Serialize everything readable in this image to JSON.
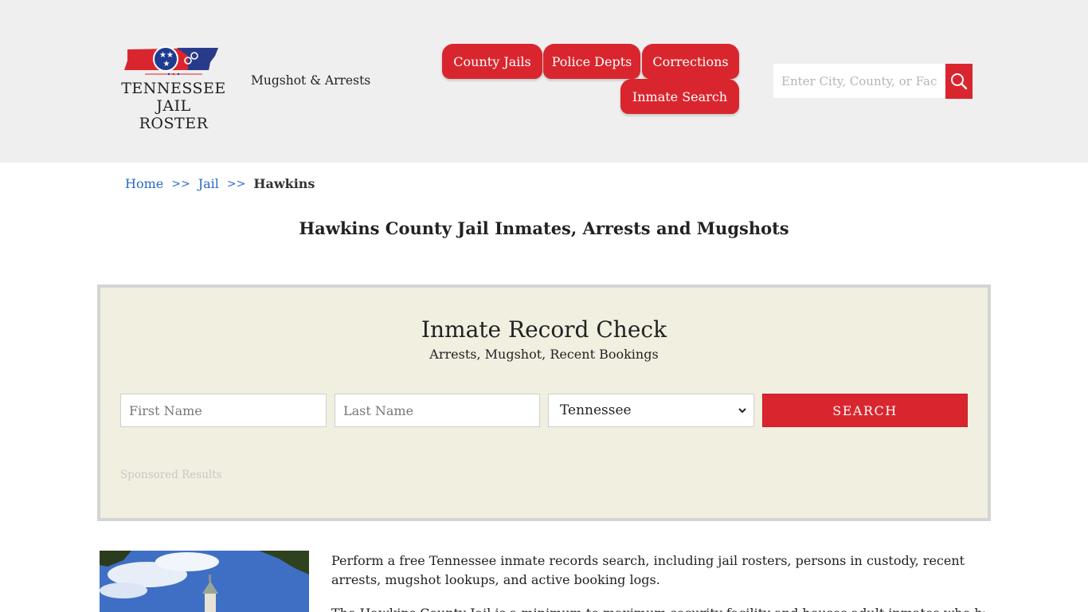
{
  "header": {
    "logo_line1": "TENNESSEE",
    "logo_line2": "JAIL ROSTER",
    "tagline": "Mugshot & Arrests",
    "nav": {
      "county_jails": "County Jails",
      "police_depts": "Police Depts",
      "corrections": "Corrections",
      "inmate_search": "Inmate Search"
    },
    "search_placeholder": "Enter City, County, or Facility",
    "search_icon": "magnifier-icon",
    "brand_red": "#d9262e",
    "brand_blue": "#1e3c8f"
  },
  "breadcrumb": {
    "home": "Home",
    "sep": ">>",
    "jail": "Jail",
    "current": "Hawkins"
  },
  "page_title": "Hawkins County Jail Inmates, Arrests and Mugshots",
  "record_check": {
    "title": "Inmate Record Check",
    "subtitle": "Arrests, Mugshot, Recent Bookings",
    "first_name_placeholder": "First Name",
    "last_name_placeholder": "Last Name",
    "state_selected": "Tennessee",
    "search_label": "SEARCH",
    "sponsored": "Sponsored Results"
  },
  "content": {
    "intro": "Perform a free Tennessee inmate records search, including jail rosters, persons in custody, recent arrests, mugshot lookups, and active booking logs.",
    "intro2": "The Hawkins County Jail is a minimum to maximum security facility and houses adult inmates who have"
  }
}
